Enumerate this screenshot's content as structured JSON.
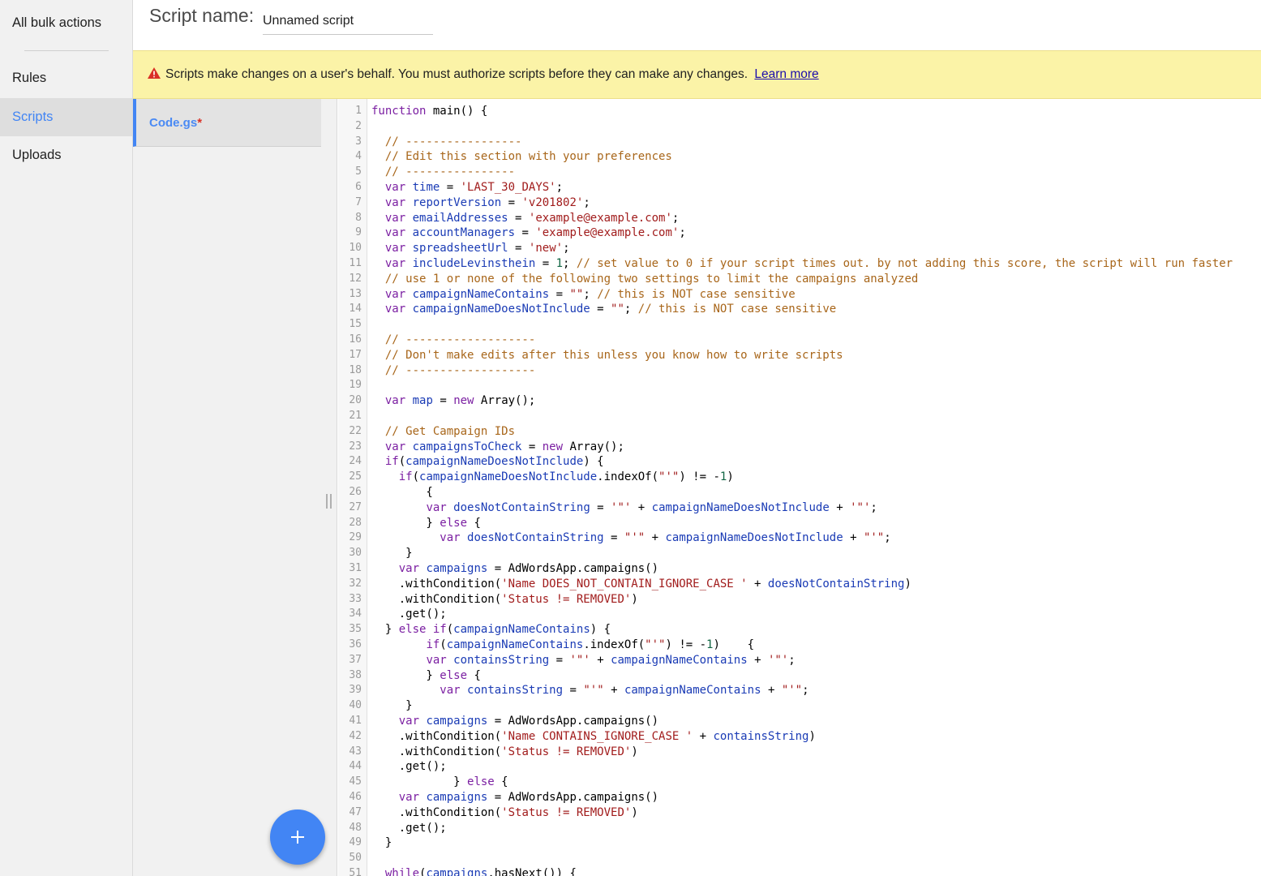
{
  "nav": {
    "items": [
      {
        "label": "All bulk actions",
        "active": false
      },
      {
        "label": "Rules",
        "active": false
      },
      {
        "label": "Scripts",
        "active": true
      },
      {
        "label": "Uploads",
        "active": false
      }
    ]
  },
  "header": {
    "label": "Script name:",
    "script_name_value": "Unnamed script"
  },
  "banner": {
    "message": "Scripts make changes on a user's behalf. You must authorize scripts before they can make any changes.",
    "link": "Learn more"
  },
  "files": {
    "current": "Code.gs",
    "unsaved_marker": "*"
  },
  "colors": {
    "accent": "#4285f4",
    "banner_bg": "#fbf3a7",
    "warning_icon": "#d93025",
    "keyword": "#7b1fa2",
    "variable": "#1a3bb5",
    "string": "#a11c1c",
    "comment": "#a8661a"
  },
  "icons": {
    "warning": "warning-triangle-icon",
    "add": "plus-icon",
    "resize": "vertical-grip-icon"
  },
  "code_lines": [
    [
      [
        "kw",
        "function"
      ],
      [
        "t",
        " main() {"
      ]
    ],
    [],
    [
      [
        "t",
        "  "
      ],
      [
        "com",
        "// -----------------"
      ]
    ],
    [
      [
        "t",
        "  "
      ],
      [
        "com",
        "// Edit this section with your preferences"
      ]
    ],
    [
      [
        "t",
        "  "
      ],
      [
        "com",
        "// ----------------"
      ]
    ],
    [
      [
        "t",
        "  "
      ],
      [
        "kw",
        "var"
      ],
      [
        "t",
        " "
      ],
      [
        "var",
        "time"
      ],
      [
        "t",
        " = "
      ],
      [
        "str",
        "'LAST_30_DAYS'"
      ],
      [
        "t",
        ";"
      ]
    ],
    [
      [
        "t",
        "  "
      ],
      [
        "kw",
        "var"
      ],
      [
        "t",
        " "
      ],
      [
        "var",
        "reportVersion"
      ],
      [
        "t",
        " = "
      ],
      [
        "str",
        "'v201802'"
      ],
      [
        "t",
        ";"
      ]
    ],
    [
      [
        "t",
        "  "
      ],
      [
        "kw",
        "var"
      ],
      [
        "t",
        " "
      ],
      [
        "var",
        "emailAddresses"
      ],
      [
        "t",
        " = "
      ],
      [
        "str",
        "'example@example.com'"
      ],
      [
        "t",
        ";"
      ]
    ],
    [
      [
        "t",
        "  "
      ],
      [
        "kw",
        "var"
      ],
      [
        "t",
        " "
      ],
      [
        "var",
        "accountManagers"
      ],
      [
        "t",
        " = "
      ],
      [
        "str",
        "'example@example.com'"
      ],
      [
        "t",
        ";"
      ]
    ],
    [
      [
        "t",
        "  "
      ],
      [
        "kw",
        "var"
      ],
      [
        "t",
        " "
      ],
      [
        "var",
        "spreadsheetUrl"
      ],
      [
        "t",
        " = "
      ],
      [
        "str",
        "'new'"
      ],
      [
        "t",
        ";"
      ]
    ],
    [
      [
        "t",
        "  "
      ],
      [
        "kw",
        "var"
      ],
      [
        "t",
        " "
      ],
      [
        "var",
        "includeLevinsthein"
      ],
      [
        "t",
        " = "
      ],
      [
        "num",
        "1"
      ],
      [
        "t",
        "; "
      ],
      [
        "com",
        "// set value to 0 if your script times out. by not adding this score, the script will run faster"
      ]
    ],
    [
      [
        "t",
        "  "
      ],
      [
        "com",
        "// use 1 or none of the following two settings to limit the campaigns analyzed"
      ]
    ],
    [
      [
        "t",
        "  "
      ],
      [
        "kw",
        "var"
      ],
      [
        "t",
        " "
      ],
      [
        "var",
        "campaignNameContains"
      ],
      [
        "t",
        " = "
      ],
      [
        "str",
        "\"\""
      ],
      [
        "t",
        "; "
      ],
      [
        "com",
        "// this is NOT case sensitive"
      ]
    ],
    [
      [
        "t",
        "  "
      ],
      [
        "kw",
        "var"
      ],
      [
        "t",
        " "
      ],
      [
        "var",
        "campaignNameDoesNotInclude"
      ],
      [
        "t",
        " = "
      ],
      [
        "str",
        "\"\""
      ],
      [
        "t",
        "; "
      ],
      [
        "com",
        "// this is NOT case sensitive"
      ]
    ],
    [],
    [
      [
        "t",
        "  "
      ],
      [
        "com",
        "// -------------------"
      ]
    ],
    [
      [
        "t",
        "  "
      ],
      [
        "com",
        "// Don't make edits after this unless you know how to write scripts"
      ]
    ],
    [
      [
        "t",
        "  "
      ],
      [
        "com",
        "// -------------------"
      ]
    ],
    [],
    [
      [
        "t",
        "  "
      ],
      [
        "kw",
        "var"
      ],
      [
        "t",
        " "
      ],
      [
        "var",
        "map"
      ],
      [
        "t",
        " = "
      ],
      [
        "kw",
        "new"
      ],
      [
        "t",
        " Array();"
      ]
    ],
    [],
    [
      [
        "t",
        "  "
      ],
      [
        "com",
        "// Get Campaign IDs"
      ]
    ],
    [
      [
        "t",
        "  "
      ],
      [
        "kw",
        "var"
      ],
      [
        "t",
        " "
      ],
      [
        "var",
        "campaignsToCheck"
      ],
      [
        "t",
        " = "
      ],
      [
        "kw",
        "new"
      ],
      [
        "t",
        " Array();"
      ]
    ],
    [
      [
        "t",
        "  "
      ],
      [
        "kw",
        "if"
      ],
      [
        "t",
        "("
      ],
      [
        "var",
        "campaignNameDoesNotInclude"
      ],
      [
        "t",
        ") {"
      ]
    ],
    [
      [
        "t",
        "    "
      ],
      [
        "kw",
        "if"
      ],
      [
        "t",
        "("
      ],
      [
        "var",
        "campaignNameDoesNotInclude"
      ],
      [
        "t",
        ".indexOf("
      ],
      [
        "str",
        "\"'\""
      ],
      [
        "t",
        ") != -"
      ],
      [
        "num",
        "1"
      ],
      [
        "t",
        ")"
      ]
    ],
    [
      [
        "t",
        "        {"
      ]
    ],
    [
      [
        "t",
        "        "
      ],
      [
        "kw",
        "var"
      ],
      [
        "t",
        " "
      ],
      [
        "var",
        "doesNotContainString"
      ],
      [
        "t",
        " = "
      ],
      [
        "str",
        "'\"'"
      ],
      [
        "t",
        " + "
      ],
      [
        "var",
        "campaignNameDoesNotInclude"
      ],
      [
        "t",
        " + "
      ],
      [
        "str",
        "'\"'"
      ],
      [
        "t",
        ";"
      ]
    ],
    [
      [
        "t",
        "        } "
      ],
      [
        "kw",
        "else"
      ],
      [
        "t",
        " {"
      ]
    ],
    [
      [
        "t",
        "          "
      ],
      [
        "kw",
        "var"
      ],
      [
        "t",
        " "
      ],
      [
        "var",
        "doesNotContainString"
      ],
      [
        "t",
        " = "
      ],
      [
        "str",
        "\"'\""
      ],
      [
        "t",
        " + "
      ],
      [
        "var",
        "campaignNameDoesNotInclude"
      ],
      [
        "t",
        " + "
      ],
      [
        "str",
        "\"'\""
      ],
      [
        "t",
        ";"
      ]
    ],
    [
      [
        "t",
        "     }"
      ]
    ],
    [
      [
        "t",
        "    "
      ],
      [
        "kw",
        "var"
      ],
      [
        "t",
        " "
      ],
      [
        "var",
        "campaigns"
      ],
      [
        "t",
        " = AdWordsApp.campaigns()"
      ]
    ],
    [
      [
        "t",
        "    .withCondition("
      ],
      [
        "str",
        "'Name DOES_NOT_CONTAIN_IGNORE_CASE '"
      ],
      [
        "t",
        " + "
      ],
      [
        "var",
        "doesNotContainString"
      ],
      [
        "t",
        ")"
      ]
    ],
    [
      [
        "t",
        "    .withCondition("
      ],
      [
        "str",
        "'Status != REMOVED'"
      ],
      [
        "t",
        ")"
      ]
    ],
    [
      [
        "t",
        "    .get();"
      ]
    ],
    [
      [
        "t",
        "  } "
      ],
      [
        "kw",
        "else"
      ],
      [
        "t",
        " "
      ],
      [
        "kw",
        "if"
      ],
      [
        "t",
        "("
      ],
      [
        "var",
        "campaignNameContains"
      ],
      [
        "t",
        ") {"
      ]
    ],
    [
      [
        "t",
        "        "
      ],
      [
        "kw",
        "if"
      ],
      [
        "t",
        "("
      ],
      [
        "var",
        "campaignNameContains"
      ],
      [
        "t",
        ".indexOf("
      ],
      [
        "str",
        "\"'\""
      ],
      [
        "t",
        ") != -"
      ],
      [
        "num",
        "1"
      ],
      [
        "t",
        ")    {"
      ]
    ],
    [
      [
        "t",
        "        "
      ],
      [
        "kw",
        "var"
      ],
      [
        "t",
        " "
      ],
      [
        "var",
        "containsString"
      ],
      [
        "t",
        " = "
      ],
      [
        "str",
        "'\"'"
      ],
      [
        "t",
        " + "
      ],
      [
        "var",
        "campaignNameContains"
      ],
      [
        "t",
        " + "
      ],
      [
        "str",
        "'\"'"
      ],
      [
        "t",
        ";"
      ]
    ],
    [
      [
        "t",
        "        } "
      ],
      [
        "kw",
        "else"
      ],
      [
        "t",
        " {"
      ]
    ],
    [
      [
        "t",
        "          "
      ],
      [
        "kw",
        "var"
      ],
      [
        "t",
        " "
      ],
      [
        "var",
        "containsString"
      ],
      [
        "t",
        " = "
      ],
      [
        "str",
        "\"'\""
      ],
      [
        "t",
        " + "
      ],
      [
        "var",
        "campaignNameContains"
      ],
      [
        "t",
        " + "
      ],
      [
        "str",
        "\"'\""
      ],
      [
        "t",
        ";"
      ]
    ],
    [
      [
        "t",
        "     }"
      ]
    ],
    [
      [
        "t",
        "    "
      ],
      [
        "kw",
        "var"
      ],
      [
        "t",
        " "
      ],
      [
        "var",
        "campaigns"
      ],
      [
        "t",
        " = AdWordsApp.campaigns()"
      ]
    ],
    [
      [
        "t",
        "    .withCondition("
      ],
      [
        "str",
        "'Name CONTAINS_IGNORE_CASE '"
      ],
      [
        "t",
        " + "
      ],
      [
        "var",
        "containsString"
      ],
      [
        "t",
        ")"
      ]
    ],
    [
      [
        "t",
        "    .withCondition("
      ],
      [
        "str",
        "'Status != REMOVED'"
      ],
      [
        "t",
        ")"
      ]
    ],
    [
      [
        "t",
        "    .get();"
      ]
    ],
    [
      [
        "t",
        "            } "
      ],
      [
        "kw",
        "else"
      ],
      [
        "t",
        " {"
      ]
    ],
    [
      [
        "t",
        "    "
      ],
      [
        "kw",
        "var"
      ],
      [
        "t",
        " "
      ],
      [
        "var",
        "campaigns"
      ],
      [
        "t",
        " = AdWordsApp.campaigns()"
      ]
    ],
    [
      [
        "t",
        "    .withCondition("
      ],
      [
        "str",
        "'Status != REMOVED'"
      ],
      [
        "t",
        ")"
      ]
    ],
    [
      [
        "t",
        "    .get();"
      ]
    ],
    [
      [
        "t",
        "  }"
      ]
    ],
    [],
    [
      [
        "t",
        "  "
      ],
      [
        "kw",
        "while"
      ],
      [
        "t",
        "("
      ],
      [
        "var",
        "campaigns"
      ],
      [
        "t",
        ".hasNext()) {"
      ]
    ]
  ]
}
